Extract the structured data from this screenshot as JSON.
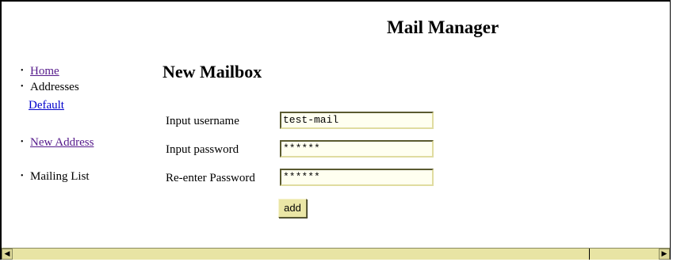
{
  "app": {
    "title": "Mail Manager"
  },
  "nav": {
    "items": [
      {
        "label": "Home",
        "link": true
      },
      {
        "label": "Addresses",
        "link": false
      },
      {
        "label": "Default",
        "link": true
      },
      {
        "label": "New Address",
        "link": true
      },
      {
        "label": "Mailing List",
        "link": false
      }
    ]
  },
  "form": {
    "title": "New Mailbox",
    "username_label": "Input username",
    "username_value": "test-mail",
    "password_label": "Input password",
    "password_value": "******",
    "reenter_label": "Re-enter Password",
    "reenter_value": "******",
    "add_label": "add"
  },
  "colors": {
    "link_visited": "#551a8b",
    "link": "#0000cc",
    "field_bg": "#fffff0",
    "button_bg": "#eae6a6",
    "scrollbar_bg": "#e8e4a4"
  }
}
